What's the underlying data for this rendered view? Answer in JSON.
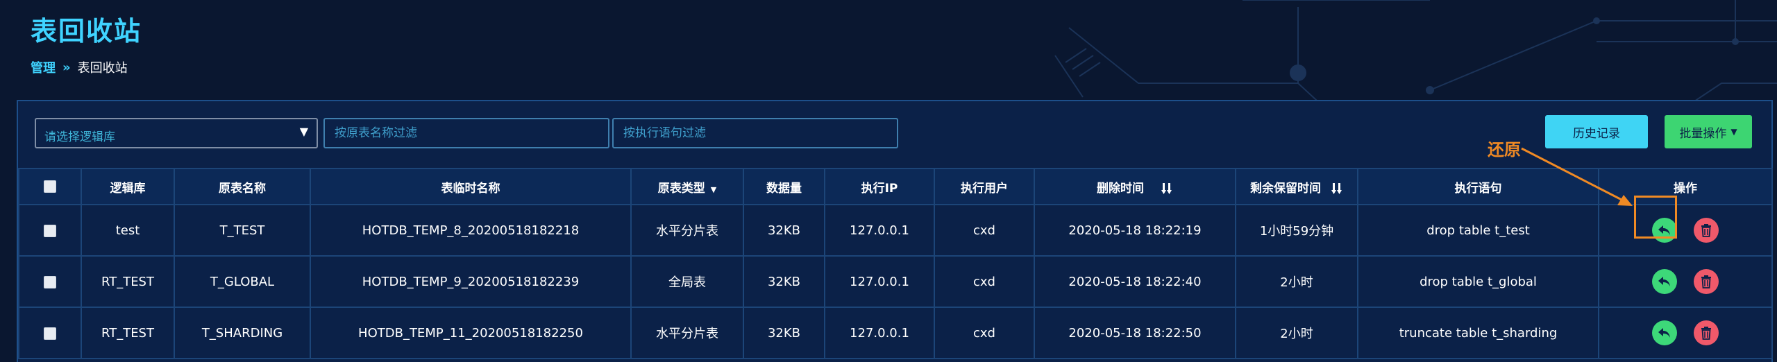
{
  "page": {
    "title": "表回收站"
  },
  "breadcrumb": {
    "parent": "管理",
    "separator": "»",
    "current": "表回收站"
  },
  "toolbar": {
    "db_select_placeholder": "请选择逻辑库",
    "table_filter_placeholder": "按原表名称过滤",
    "sql_filter_placeholder": "按执行语句过滤",
    "history_label": "历史记录",
    "batch_label": "批量操作"
  },
  "annotation": {
    "label": "还原",
    "color": "#f08a24"
  },
  "table": {
    "columns": {
      "db": "逻辑库",
      "orig_name": "原表名称",
      "temp_name": "表临时名称",
      "orig_type": "原表类型",
      "data_size": "数据量",
      "exec_ip": "执行IP",
      "exec_user": "执行用户",
      "delete_time": "删除时间",
      "remaining": "剩余保留时间",
      "sql": "执行语句",
      "ops": "操作"
    },
    "rows": [
      {
        "db": "test",
        "orig_name": "T_TEST",
        "temp_name": "HOTDB_TEMP_8_20200518182218",
        "orig_type": "水平分片表",
        "data_size": "32KB",
        "exec_ip": "127.0.0.1",
        "exec_user": "cxd",
        "delete_time": "2020-05-18 18:22:19",
        "remaining": "1小时59分钟",
        "sql": "drop table t_test"
      },
      {
        "db": "RT_TEST",
        "orig_name": "T_GLOBAL",
        "temp_name": "HOTDB_TEMP_9_20200518182239",
        "orig_type": "全局表",
        "data_size": "32KB",
        "exec_ip": "127.0.0.1",
        "exec_user": "cxd",
        "delete_time": "2020-05-18 18:22:40",
        "remaining": "2小时",
        "sql": "drop table t_global"
      },
      {
        "db": "RT_TEST",
        "orig_name": "T_SHARDING",
        "temp_name": "HOTDB_TEMP_11_20200518182250",
        "orig_type": "水平分片表",
        "data_size": "32KB",
        "exec_ip": "127.0.0.1",
        "exec_user": "cxd",
        "delete_time": "2020-05-18 18:22:50",
        "remaining": "2小时",
        "sql": "truncate table t_sharding"
      }
    ]
  },
  "colors": {
    "background": "#0a1730",
    "accent": "#3fd3ff",
    "restore": "#3dd879",
    "delete": "#f0596a",
    "history_button": "#3fd4f4",
    "batch_button": "#3dd572"
  }
}
